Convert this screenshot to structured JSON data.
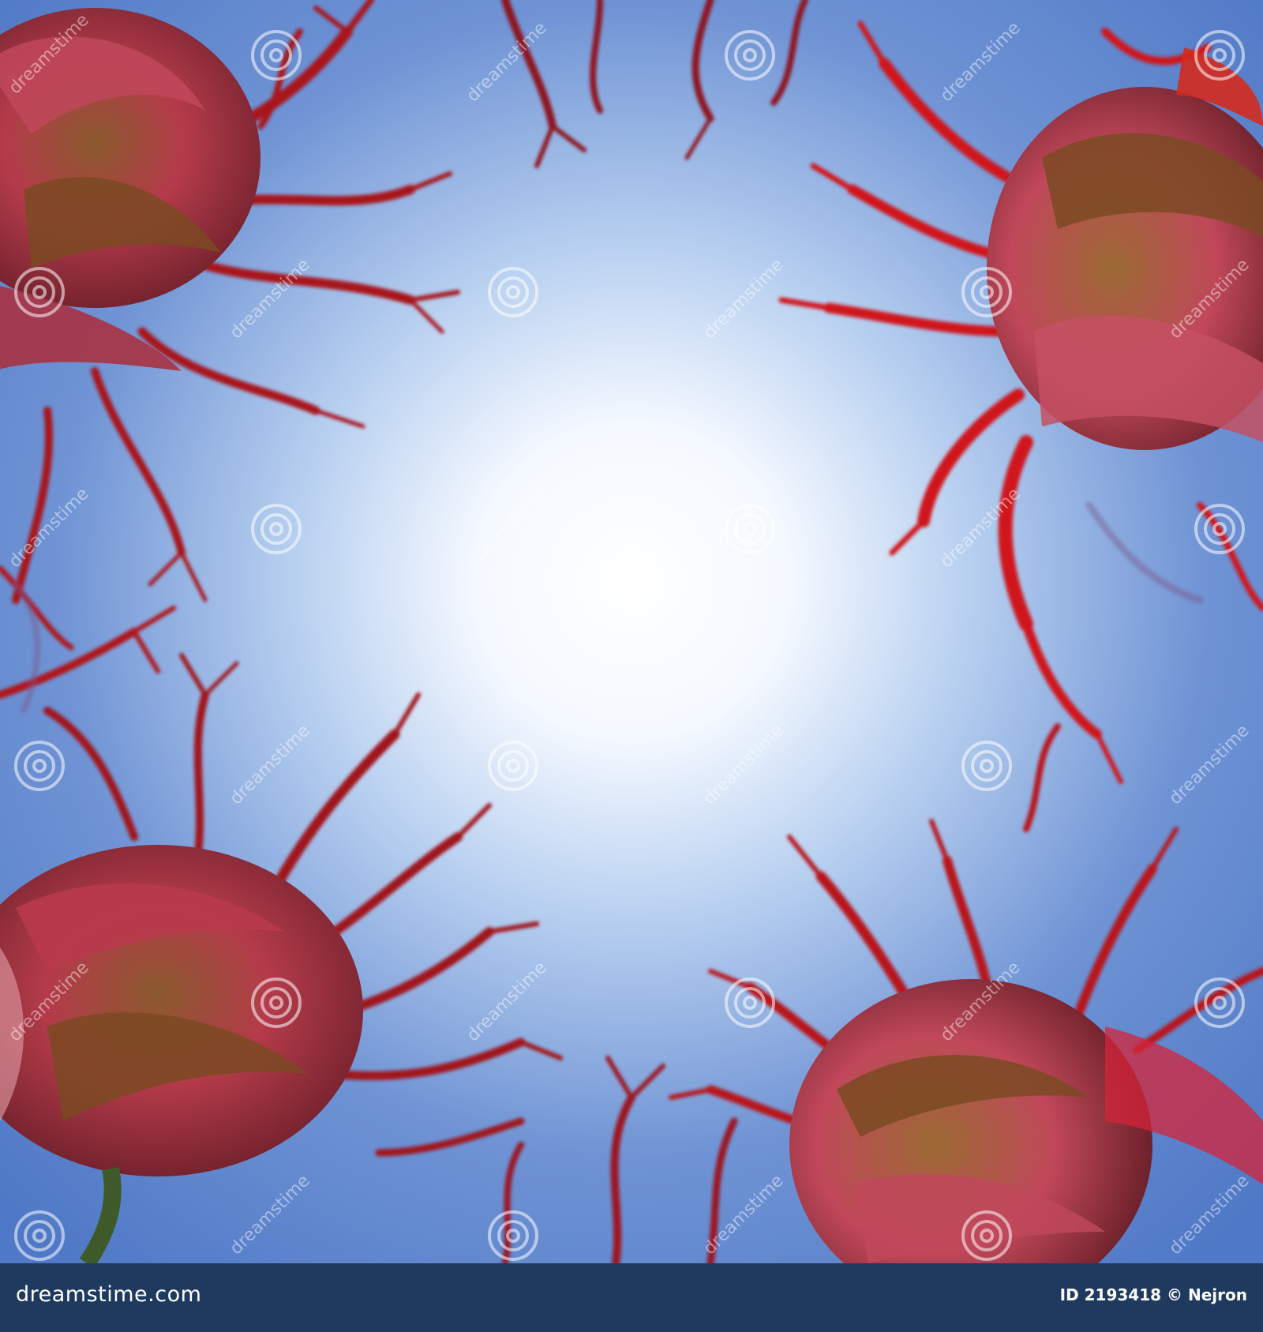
{
  "watermark": {
    "text": "dreamstime",
    "logo_icon": "dreamstime-spiral-icon"
  },
  "footer": {
    "site": "dreamstime.com",
    "id_label": "ID",
    "image_id": "2193418",
    "copyright_symbol": "©",
    "author": "Nejron"
  },
  "colors": {
    "sky_glow": "#ffffff",
    "sky_mid": "#b8d0f0",
    "sky_edge": "#4f78c6",
    "vein_red": "#c4161c",
    "vein_dark": "#7a0f1a",
    "rose_petal": "#b43b4a",
    "rose_shadow": "#6b3a22",
    "footer_bg": "#1f3a5f"
  }
}
